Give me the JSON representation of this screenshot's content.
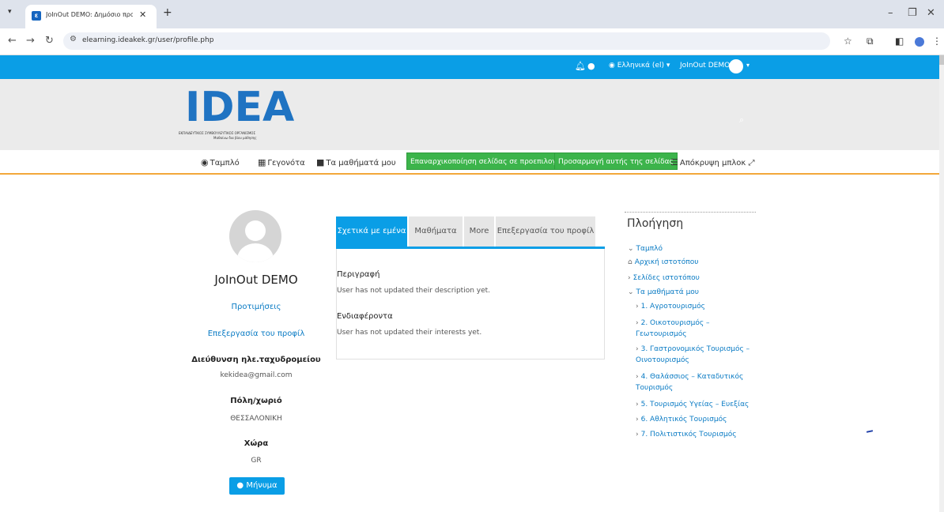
{
  "browser": {
    "tab_title": "JoInOut DEMO: Δημόσιο προφ",
    "tab_favicon": "ideakek-favicon",
    "url": "elearning.ideakek.gr/user/profile.php"
  },
  "topnav": {
    "language": "Ελληνικά (el)",
    "user_name": "JoInOut DEMO"
  },
  "logo": {
    "letters": "IDEA",
    "subtitle_line1": "ΕΚΠΑΙΔΕΥΤΙΚΟΣ ΣΥΜΒΟΥΛΕΥΤΙΚΟΣ ΟΡΓΑΝΙΣΜΟΣ",
    "subtitle_line2": "Μαθαίνω δια βίου μάθησης"
  },
  "menu": {
    "dashboard": "Ταμπλό",
    "events": "Γεγονότα",
    "my_courses": "Τα μαθήματά μου",
    "reset_page": "Επαναρχικοποίηση σελίδας σε προεπιλογή",
    "customize_page": "Προσαρμογή αυτής της σελίδας",
    "hide_blocks": "Απόκρυψη μπλοκ"
  },
  "profile": {
    "name": "JoInOut DEMO",
    "preferences": "Προτιμήσεις",
    "edit_profile": "Επεξεργασία του προφίλ",
    "email_label": "Διεύθυνση ηλε.ταχυδρομείου",
    "email": "kekidea@gmail.com",
    "city_label": "Πόλη/χωριό",
    "city": "ΘΕΣΣΑΛΟΝΙΚΗ",
    "country_label": "Χώρα",
    "country": "GR",
    "message_button": "Μήνυμα"
  },
  "tabs": [
    {
      "label": "Σχετικά με εμένα",
      "active": true
    },
    {
      "label": "Μαθήματα",
      "active": false
    },
    {
      "label": "More",
      "active": false
    },
    {
      "label": "Επεξεργασία του προφίλ",
      "active": false
    }
  ],
  "about": {
    "description_heading": "Περιγραφή",
    "description_text": "User has not updated their description yet.",
    "interests_heading": "Ενδιαφέροντα",
    "interests_text": "User has not updated their interests yet."
  },
  "navigation": {
    "title": "Πλοήγηση",
    "dashboard": "Ταμπλό",
    "home": "Αρχική ιστοτόπου",
    "site_pages": "Σελίδες ιστοτόπου",
    "my_courses": "Τα μαθήματά μου",
    "courses": [
      [
        "1. Αγροτουρισμός"
      ],
      [
        "2. Οικοτουρισμός –",
        "Γεωτουρισμός"
      ],
      [
        "3. Γαστρονομικός Τουρισμός –",
        "Οινοτουρισμός"
      ],
      [
        "4. Θαλάσσιος – Καταδυτικός",
        "Τουρισμός"
      ],
      [
        "5. Τουρισμός Υγείας – Ευεξίας"
      ],
      [
        "6. Αθλητικός Τουρισμός"
      ],
      [
        "7. Πολιτιστικός Τουρισμός"
      ]
    ]
  },
  "colors": {
    "topbar": "#0a9ee6",
    "accent_border": "#f3a83b",
    "green_button": "#3cb44b",
    "link": "#0a7bc4"
  }
}
